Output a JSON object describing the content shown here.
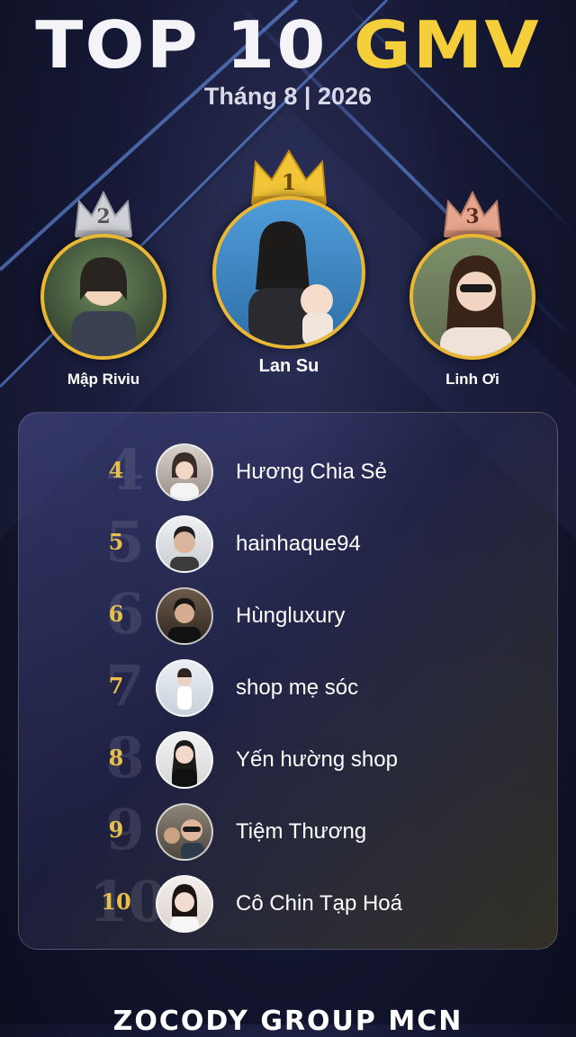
{
  "header": {
    "title_part1": "TOP 10",
    "title_part2": "GMV",
    "subtitle": "Tháng 8 | 2026"
  },
  "podium": [
    {
      "rank": "1",
      "name": "Lan Su",
      "crown_color": "#f2c437"
    },
    {
      "rank": "2",
      "name": "Mập Riviu",
      "crown_color": "#d8d9de"
    },
    {
      "rank": "3",
      "name": "Linh Ơi",
      "crown_color": "#e6a58d"
    }
  ],
  "list": [
    {
      "rank": "4",
      "name": "Hương Chia Sẻ"
    },
    {
      "rank": "5",
      "name": "hainhaque94"
    },
    {
      "rank": "6",
      "name": "Hùngluxury"
    },
    {
      "rank": "7",
      "name": "shop mẹ sóc"
    },
    {
      "rank": "8",
      "name": "Yến hường shop"
    },
    {
      "rank": "9",
      "name": "Tiệm Thương"
    },
    {
      "rank": "10",
      "name": "Cô Chin Tạp Hoá"
    }
  ],
  "footer": {
    "brand": "ZOCODY GROUP MCN"
  },
  "colors": {
    "gold": "#e9b733",
    "title_gold": "#f5cf3a",
    "background": "#161935"
  }
}
